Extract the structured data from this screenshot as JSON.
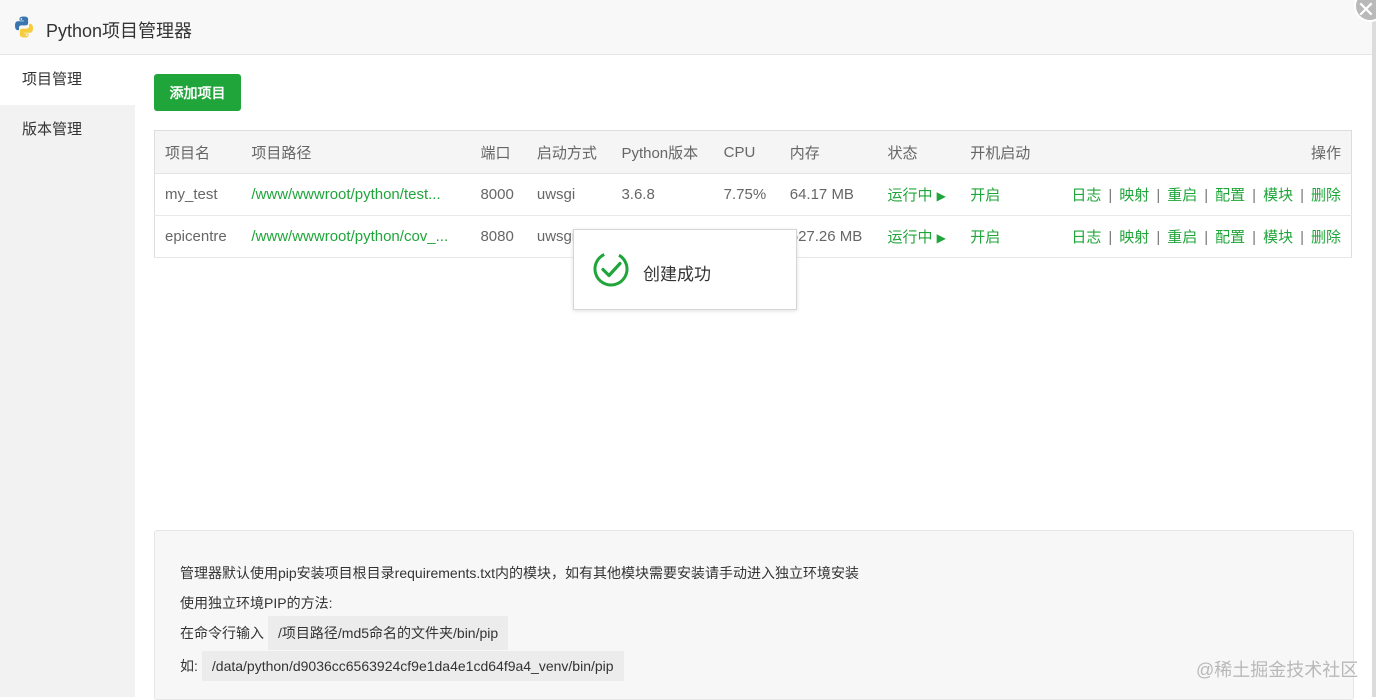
{
  "window": {
    "title": "Python项目管理器",
    "close_symbol": "✕"
  },
  "sidebar": {
    "items": [
      {
        "label": "项目管理",
        "active": true
      },
      {
        "label": "版本管理",
        "active": false
      }
    ]
  },
  "toolbar": {
    "add_label": "添加项目"
  },
  "table": {
    "headers": [
      "项目名",
      "项目路径",
      "端口",
      "启动方式",
      "Python版本",
      "CPU",
      "内存",
      "状态",
      "开机启动",
      "操作"
    ],
    "rows": [
      {
        "name": "my_test",
        "path": "/www/wwwroot/python/test...",
        "port": "8000",
        "method": "uwsgi",
        "version": "3.6.8",
        "cpu": "7.75%",
        "mem": "64.17 MB",
        "status": "运行中",
        "autostart": "开启"
      },
      {
        "name": "epicentre",
        "path": "/www/wwwroot/python/cov_...",
        "port": "8080",
        "method": "uwsgi",
        "version": "",
        "cpu": "",
        "mem": "527.26 MB",
        "status": "运行中",
        "autostart": "开启"
      }
    ],
    "actions": [
      "日志",
      "映射",
      "重启",
      "配置",
      "模块",
      "删除"
    ],
    "action_separator": "|",
    "status_icon": "▶"
  },
  "toast": {
    "message": "创建成功",
    "icon": "check-circle-icon"
  },
  "info": {
    "line1": "管理器默认使用pip安装项目根目录requirements.txt内的模块，如有其他模块需要安装请手动进入独立环境安装",
    "line2": "使用独立环境PIP的方法:",
    "line3_label": "在命令行输入",
    "line3_code": "/项目路径/md5命名的文件夹/bin/pip",
    "line4_label": "如:",
    "line4_code": "/data/python/d9036cc6563924cf9e1da4e1cd64f9a4_venv/bin/pip"
  },
  "watermark": "@稀土掘金技术社区",
  "colors": {
    "accent": "#20a53a",
    "sidebar_bg": "#f2f2f2",
    "header_bg": "#f5f5f5"
  }
}
